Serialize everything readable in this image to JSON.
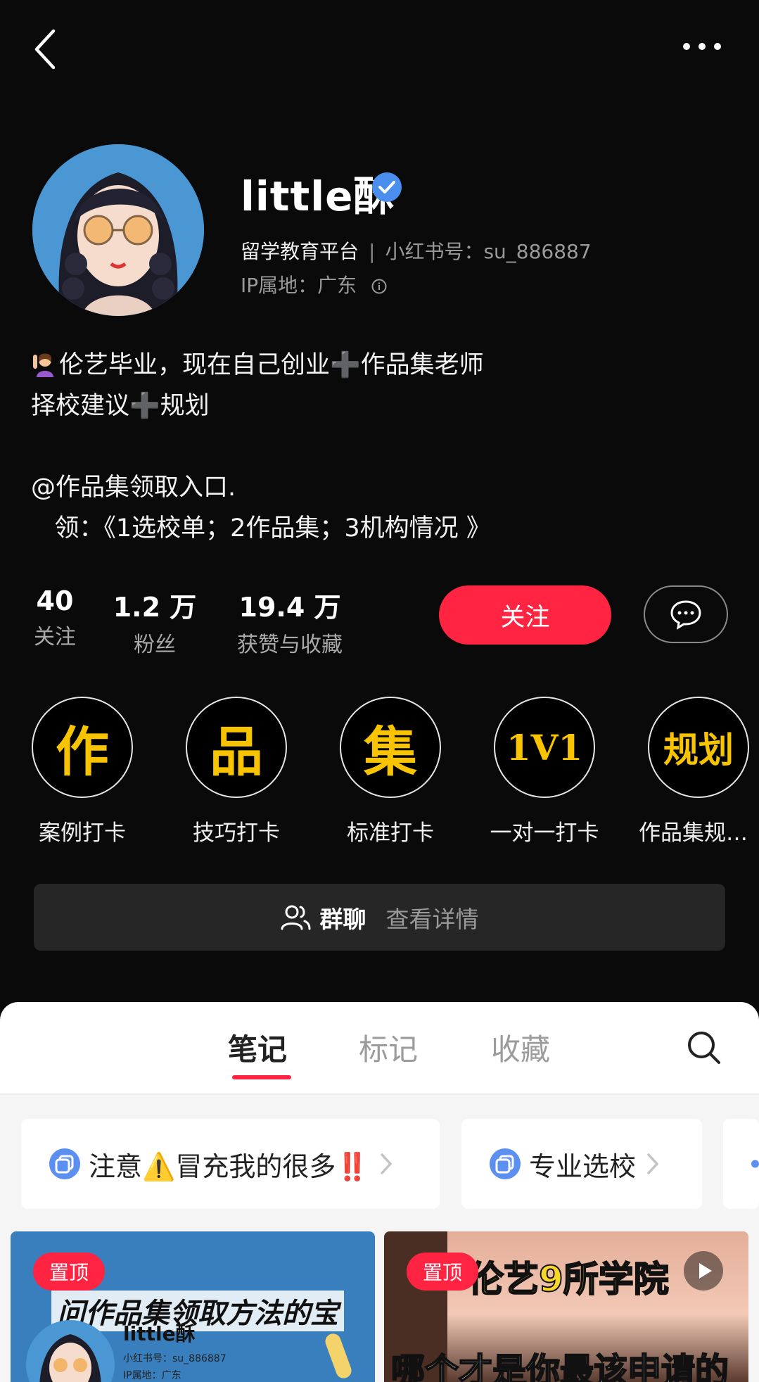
{
  "profile": {
    "username": "little酥",
    "category": "留学教育平台",
    "red_id": "小红书号：su_886887",
    "ip_location": "IP属地：广东",
    "bio_line1_a": "伦艺毕业，现在自己创业",
    "bio_line1_b": "作品集老师",
    "bio_line2_a": "择校建议",
    "bio_line2_b": "规划",
    "bio_plus": "➕",
    "bio_line3": "@作品集领取入口.",
    "bio_line4": "   领：《1选校单；2作品集；3机构情况 》"
  },
  "stats": [
    {
      "value": "40",
      "label": "关注"
    },
    {
      "value": "1.2 万",
      "label": "粉丝"
    },
    {
      "value": "19.4 万",
      "label": "获赞与收藏"
    }
  ],
  "actions": {
    "follow_label": "关注"
  },
  "shortcuts": [
    {
      "glyph": "作",
      "label": "案例打卡"
    },
    {
      "glyph": "品",
      "label": "技巧打卡"
    },
    {
      "glyph": "集",
      "label": "标准打卡"
    },
    {
      "glyph": "1V1",
      "label": "一对一打卡"
    },
    {
      "glyph": "规划",
      "label": "作品集规…"
    }
  ],
  "group_chat": {
    "title": "群聊",
    "detail": "查看详情"
  },
  "tabs": [
    {
      "label": "笔记",
      "active": true
    },
    {
      "label": "标记",
      "active": false
    },
    {
      "label": "收藏",
      "active": false
    }
  ],
  "collections": [
    {
      "label": "注意⚠️冒充我的很多‼️"
    },
    {
      "label": "专业选校"
    }
  ],
  "notes": [
    {
      "badge": "置顶",
      "title": "问作品集领取方法的宝",
      "thumb_username": "little酥",
      "thumb_red_id": "小红书号：su_886887",
      "thumb_ip": "IP属地：广东"
    },
    {
      "badge": "置顶",
      "title": "伦艺9所学院",
      "subtitle": "哪个才是你最该申请的"
    }
  ],
  "colors": {
    "accent": "#ff2442",
    "background": "#0a0a0a",
    "shortcut_text": "#f8c400",
    "verified": "#4a8ef0"
  },
  "icons": [
    "back-icon",
    "more-icon",
    "verified-icon",
    "info-icon",
    "message-icon",
    "group-icon",
    "search-icon",
    "collection-icon",
    "chevron-right-icon",
    "play-icon"
  ]
}
